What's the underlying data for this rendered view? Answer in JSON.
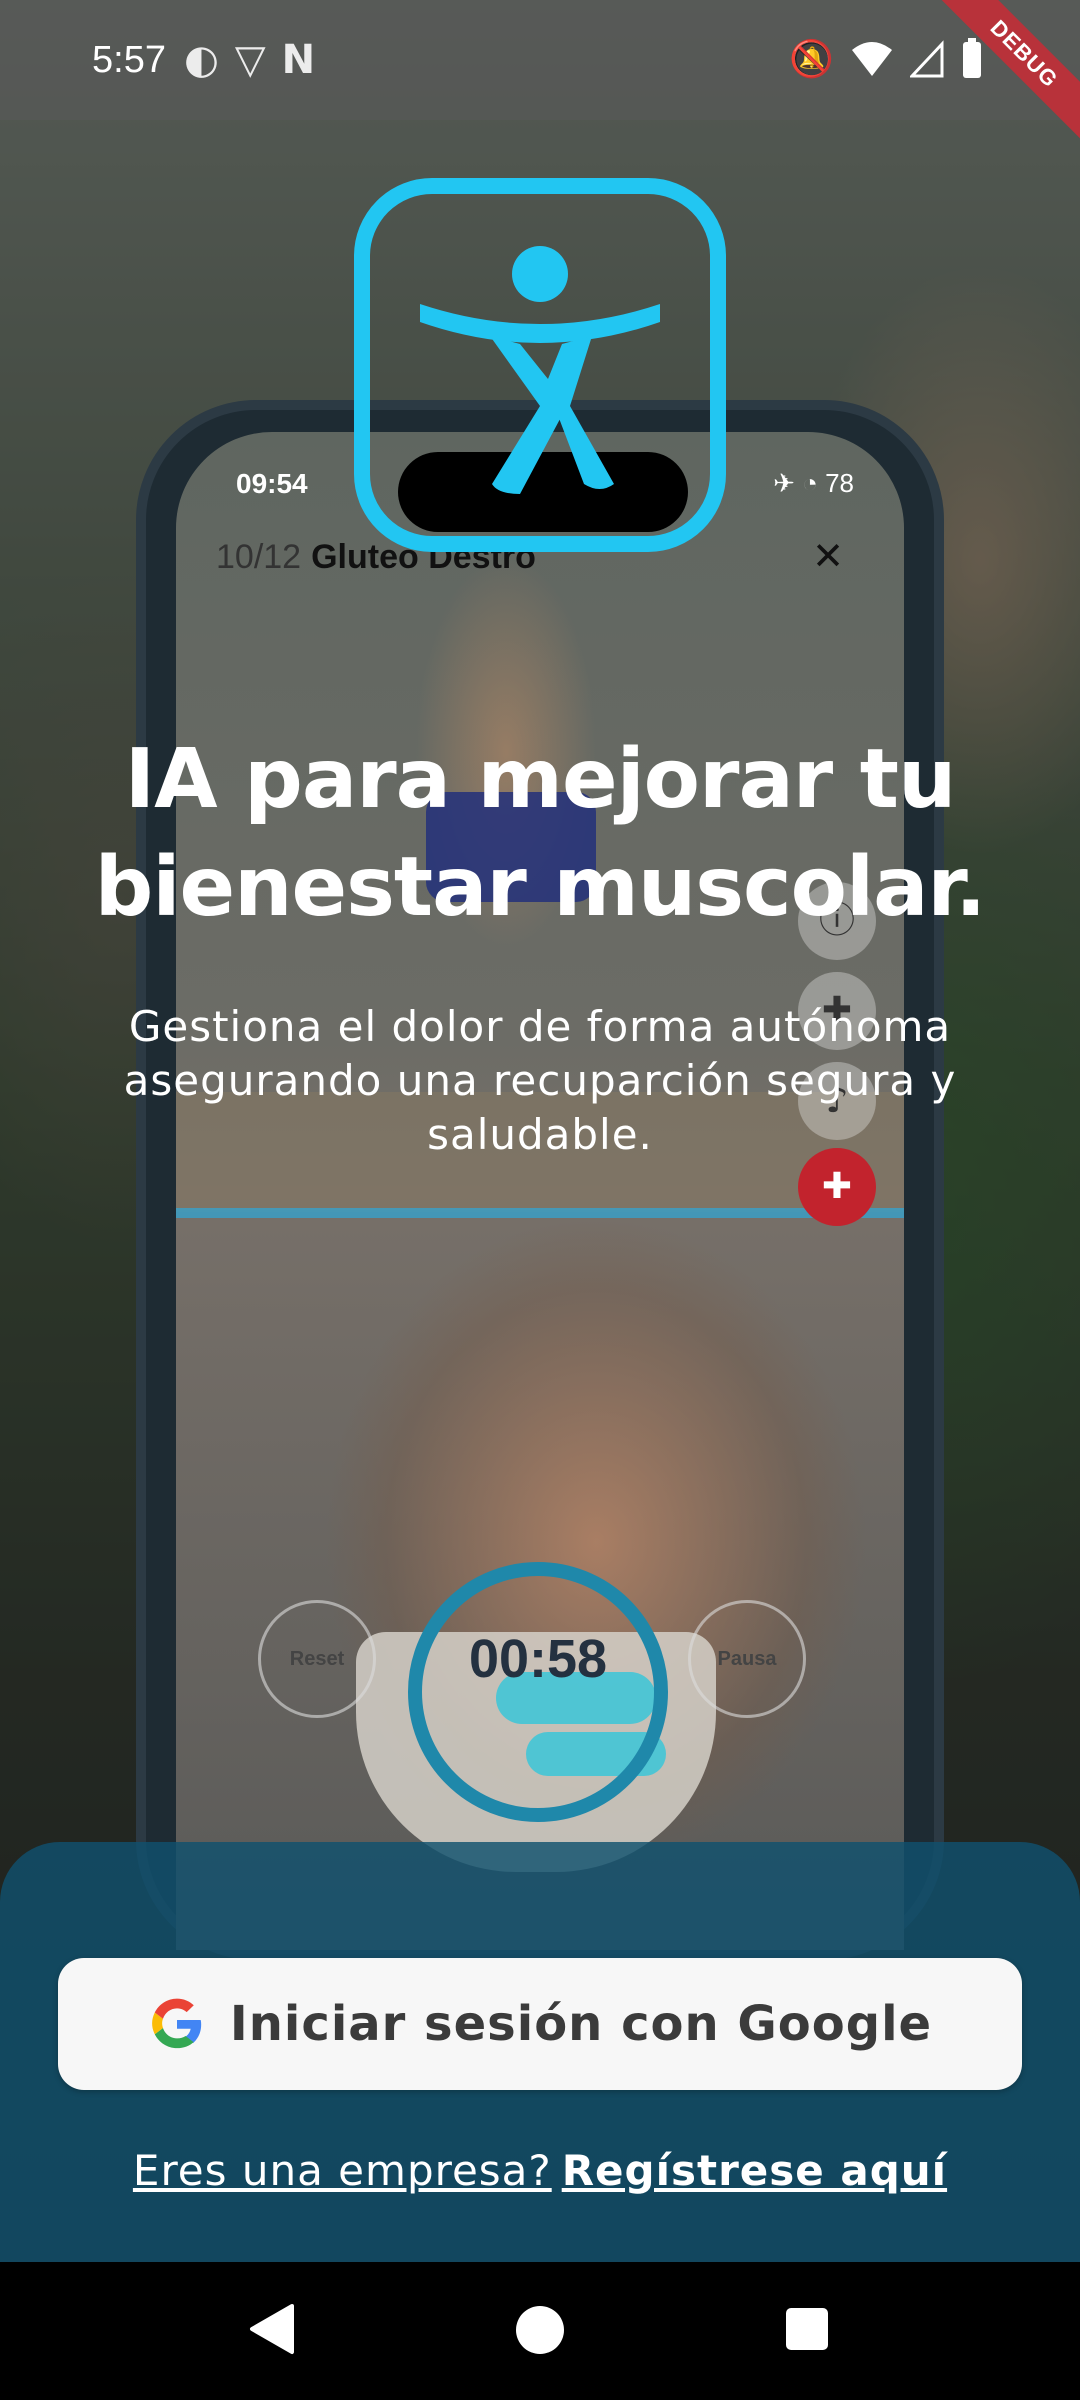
{
  "status_bar": {
    "time": "5:57",
    "left_icons": [
      "sync-icon",
      "vpn-icon",
      "n-icon"
    ],
    "right_icons": [
      "mute-icon",
      "wifi-icon",
      "signal-icon",
      "battery-icon"
    ],
    "debug_label": "DEBUG"
  },
  "phone_preview": {
    "time": "09:54",
    "battery": "78",
    "counter": "10/12",
    "title": "Gluteo Destro",
    "reset_label": "Reset",
    "pause_label": "Pausa",
    "timer": "00:58"
  },
  "headline": {
    "line1": "IA para mejorar tu",
    "line2": "bienestar muscolar."
  },
  "subtitle": "Gestiona el dolor de forma autónoma asegurando una recuparción segura y saludable.",
  "google_button": {
    "label": "Iniciar sesión con Google"
  },
  "company": {
    "question": "Eres una empresa?",
    "cta": "Regístrese aquí"
  },
  "colors": {
    "accent": "#22c6f2",
    "sheet": "#10506e",
    "button_bg": "#f7f7f7"
  }
}
